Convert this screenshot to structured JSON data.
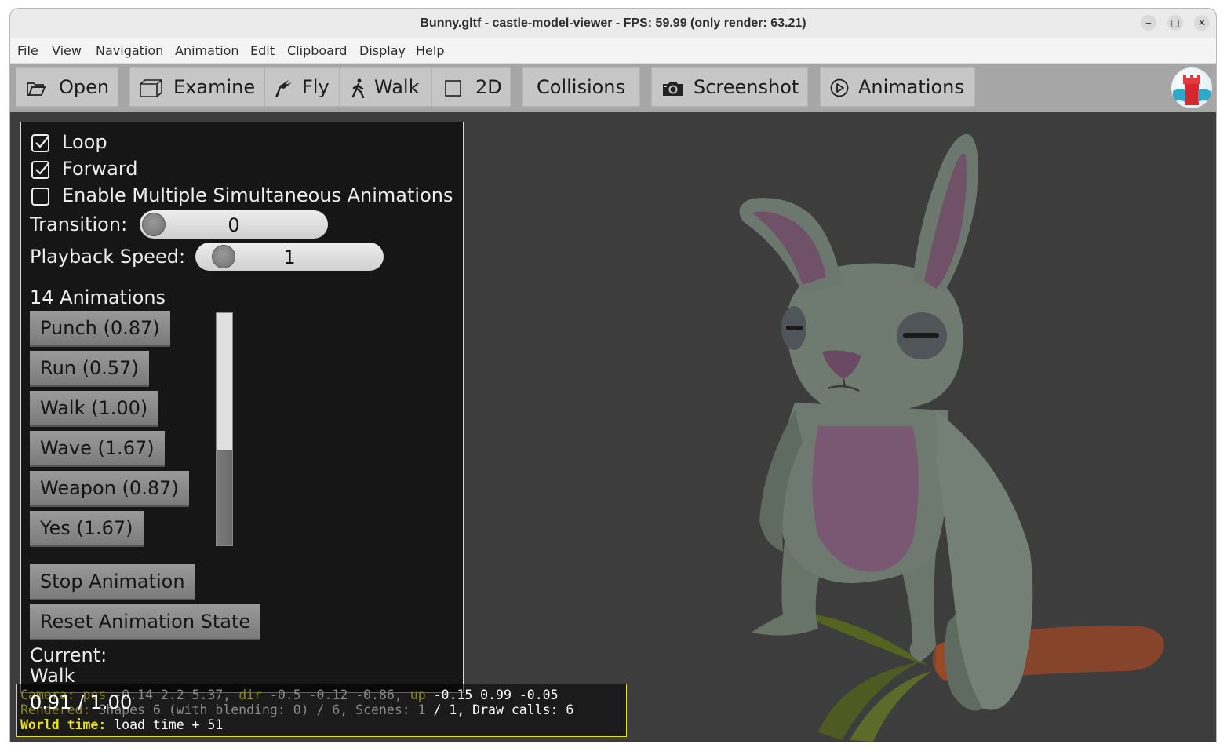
{
  "window": {
    "title": "Bunny.gltf - castle-model-viewer - FPS: 59.99 (only render: 63.21)",
    "controls": {
      "minimize": "‒",
      "maximize": "□",
      "close": "✕"
    }
  },
  "menu": [
    "File",
    "View",
    "Navigation",
    "Animation",
    "Edit",
    "Clipboard",
    "Display",
    "Help"
  ],
  "toolbar": {
    "open": "Open",
    "examine": "Examine",
    "fly": "Fly",
    "walk": "Walk",
    "two_d": "2D",
    "collisions": "Collisions",
    "screenshot": "Screenshot",
    "animations": "Animations"
  },
  "panel": {
    "loop": {
      "label": "Loop",
      "checked": true
    },
    "forward": {
      "label": "Forward",
      "checked": true
    },
    "multiple": {
      "label": "Enable Multiple Simultaneous Animations",
      "checked": false
    },
    "transition": {
      "label": "Transition:",
      "value": "0"
    },
    "playback_speed": {
      "label": "Playback Speed:",
      "value": "1"
    },
    "animations_header": "14 Animations",
    "animations": [
      {
        "label": "Punch (0.87)"
      },
      {
        "label": "Run (0.57)"
      },
      {
        "label": "Walk (1.00)"
      },
      {
        "label": "Wave (1.67)"
      },
      {
        "label": "Weapon (0.87)"
      },
      {
        "label": "Yes (1.67)"
      }
    ],
    "stop": "Stop Animation",
    "reset": "Reset Animation State",
    "current_label": "Current:",
    "current_name": "Walk",
    "current_time": "0.91 / 1.00"
  },
  "debug": {
    "camera_label": "Camera:",
    "pos_label": "pos",
    "pos": "-0.14 2.2 5.37,",
    "dir_label": "dir",
    "dir": "-0.5 -0.12 -0.86,",
    "up_label": "up",
    "up": "-0.15 0.99 -0.05",
    "rendered_label": "Rendered:",
    "rendered": "Shapes 6 (with blending: 0) / 6, Scenes: 1",
    "rendered_tail": "/ 1, Draw calls: 6",
    "world_time_label": "World time:",
    "world_time": "load time + 51"
  },
  "colors": {
    "viewport_bg": "#3d3d3d",
    "panel_bg": "#161616",
    "debug_accent": "#e8e31c",
    "bunny_body": "#6e7a72",
    "bunny_inner": "#7a5773",
    "carrot": "#8b4726"
  }
}
